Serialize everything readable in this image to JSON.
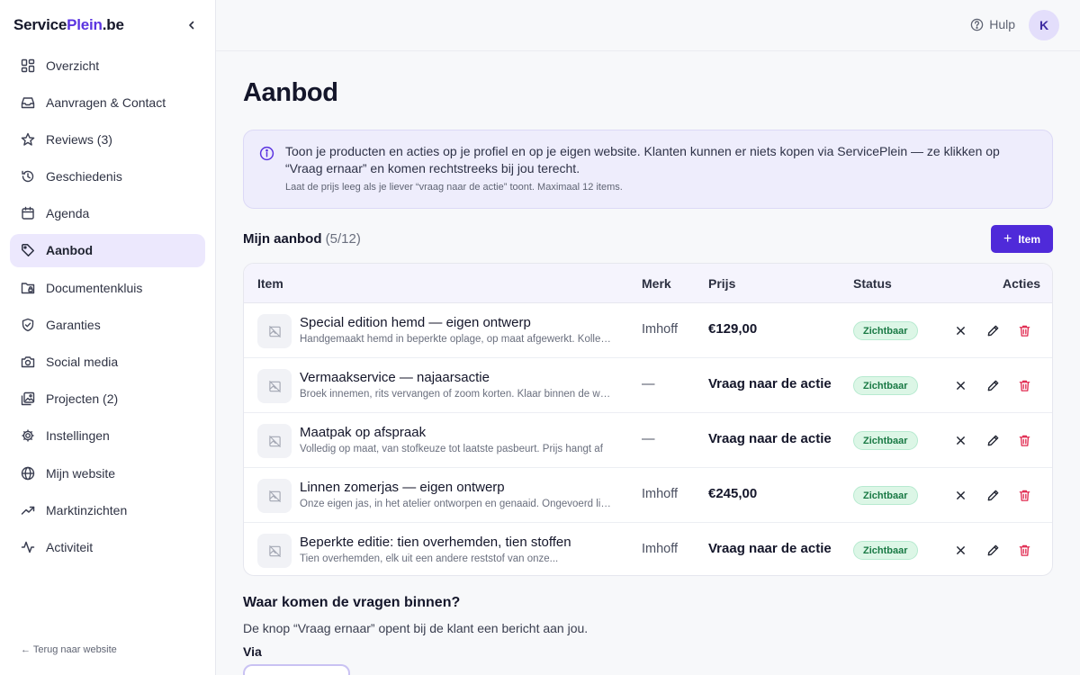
{
  "brand": {
    "part1": "Service",
    "part2": "Plein",
    "part3": ".be"
  },
  "sidebar": {
    "items": [
      {
        "label": "Overzicht",
        "icon": "grid-icon"
      },
      {
        "label": "Aanvragen & Contact",
        "icon": "inbox-icon"
      },
      {
        "label": "Reviews (3)",
        "icon": "star-icon"
      },
      {
        "label": "Geschiedenis",
        "icon": "history-icon"
      },
      {
        "label": "Agenda",
        "icon": "calendar-icon"
      },
      {
        "label": "Aanbod",
        "icon": "tag-icon",
        "active": true
      },
      {
        "label": "Documentenkluis",
        "icon": "folder-lock-icon"
      },
      {
        "label": "Garanties",
        "icon": "shield-icon"
      },
      {
        "label": "Social media",
        "icon": "camera-icon"
      },
      {
        "label": "Projecten (2)",
        "icon": "images-icon"
      },
      {
        "label": "Instellingen",
        "icon": "gear-icon"
      },
      {
        "label": "Mijn website",
        "icon": "globe-icon"
      },
      {
        "label": "Marktinzichten",
        "icon": "trend-icon"
      },
      {
        "label": "Activiteit",
        "icon": "activity-icon"
      }
    ],
    "back_link": "← Terug naar website"
  },
  "topbar": {
    "help_label": "Hulp",
    "avatar_initial": "K"
  },
  "page": {
    "title": "Aanbod",
    "info_text": "Toon je producten en acties op je profiel en op je eigen website. Klanten kunnen er niets kopen via ServicePlein — ze klikken op “Vraag ernaar” en komen rechtstreeks bij jou terecht.",
    "info_sub": "Laat de prijs leeg als je liever “vraag naar de actie” toont. Maximaal 12 items.",
    "section_title": "Mijn aanbod",
    "section_count": "(5/12)",
    "add_button": "Item"
  },
  "table": {
    "headers": {
      "item": "Item",
      "brand": "Merk",
      "price": "Prijs",
      "status": "Status",
      "actions": "Acties"
    },
    "rows": [
      {
        "title": "Special edition hemd — eigen ontwerp",
        "desc": "Handgemaakt hemd in beperkte oplage, op maat afgewerkt. Kollectie",
        "brand": "Imhoff",
        "price": "€129,00",
        "status": "Zichtbaar"
      },
      {
        "title": "Vermaakservice — najaarsactie",
        "desc": "Broek innemen, rits vervangen of zoom korten. Klaar binnen de week",
        "brand": "—",
        "price": "Vraag naar de actie",
        "status": "Zichtbaar"
      },
      {
        "title": "Maatpak op afspraak",
        "desc": "Volledig op maat, van stofkeuze tot laatste pasbeurt. Prijs hangt af",
        "brand": "—",
        "price": "Vraag naar de actie",
        "status": "Zichtbaar"
      },
      {
        "title": "Linnen zomerjas — eigen ontwerp",
        "desc": "Onze eigen jas, in het atelier ontworpen en genaaid. Ongevoerd linnen",
        "brand": "Imhoff",
        "price": "€245,00",
        "status": "Zichtbaar"
      },
      {
        "title": "Beperkte editie: tien overhemden, tien stoffen",
        "desc": "Tien overhemden, elk uit een andere reststof van onze...",
        "brand": "Imhoff",
        "price": "Vraag naar de actie",
        "status": "Zichtbaar"
      }
    ]
  },
  "questions": {
    "title": "Waar komen de vragen binnen?",
    "desc": "De knop “Vraag ernaar” opent bij de klant een bericht aan jou.",
    "via_label": "Via"
  },
  "colors": {
    "accent": "#4f2ad9",
    "active_bg": "#ece8fd",
    "status_green": "#1a7a45",
    "danger": "#e0284f"
  }
}
